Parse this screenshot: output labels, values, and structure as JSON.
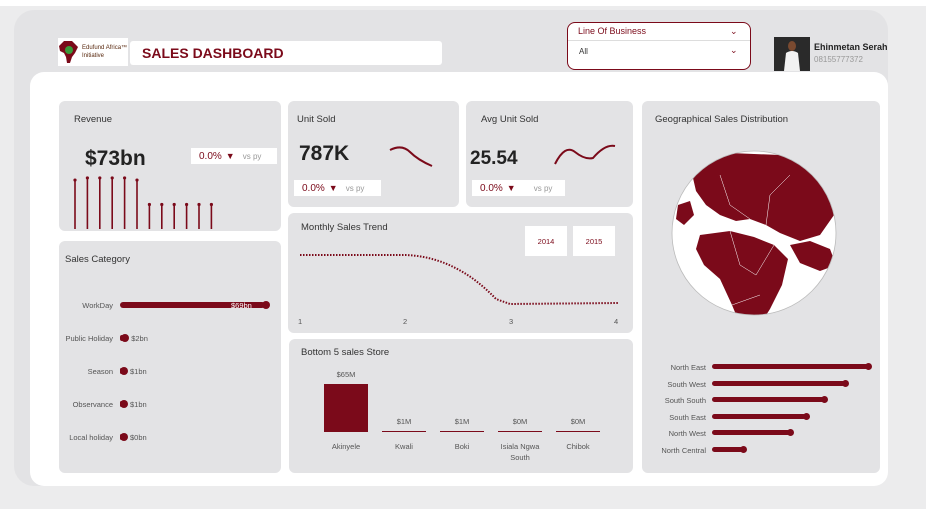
{
  "header": {
    "logo_line1": "Edufund Africa™",
    "logo_line2": "Initiative",
    "title": "SALES DASHBOARD",
    "filter_label": "Line Of Business",
    "filter_value": "All",
    "user_name": "Ehinmetan Serah",
    "user_phone": "08155777372"
  },
  "revenue": {
    "title": "Revenue",
    "value": "$73bn",
    "change": "0.0%",
    "vs": "vs py",
    "spark": [
      0.92,
      0.96,
      0.96,
      0.96,
      0.96,
      0.92,
      0.46,
      0.46,
      0.46,
      0.46,
      0.46,
      0.46
    ]
  },
  "units": {
    "title": "Unit Sold",
    "value": "787K",
    "change": "0.0%",
    "vs": "vs py"
  },
  "avg": {
    "title": "Avg Unit Sold",
    "value": "25.54",
    "change": "0.0%",
    "vs": "vs py"
  },
  "trend": {
    "title": "Monthly Sales Trend",
    "years": [
      "2014",
      "2015"
    ],
    "x_labels": [
      "1",
      "2",
      "3",
      "4"
    ]
  },
  "category": {
    "title": "Sales Category",
    "items": [
      {
        "label": "WorkDay",
        "value": "$69bn",
        "amount": 69
      },
      {
        "label": "Public Holiday",
        "value": "$2bn",
        "amount": 2
      },
      {
        "label": "Season",
        "value": "$1bn",
        "amount": 1
      },
      {
        "label": "Observance",
        "value": "$1bn",
        "amount": 1
      },
      {
        "label": "Local holiday",
        "value": "$0bn",
        "amount": 0
      }
    ]
  },
  "bottom": {
    "title": "Bottom 5 sales Store",
    "stores": [
      {
        "name": "Akinyele",
        "value": "$65M",
        "amount": 65
      },
      {
        "name": "Kwali",
        "value": "$1M",
        "amount": 1
      },
      {
        "name": "Boki",
        "value": "$1M",
        "amount": 1
      },
      {
        "name": "Isiala Ngwa South",
        "value": "$0M",
        "amount": 0
      },
      {
        "name": "Chibok",
        "value": "$0M",
        "amount": 0
      }
    ]
  },
  "geo": {
    "title": "Geographical Sales Distribution",
    "regions": [
      {
        "name": "North East",
        "amount": 1.0
      },
      {
        "name": "South West",
        "amount": 0.85
      },
      {
        "name": "South South",
        "amount": 0.72
      },
      {
        "name": "South East",
        "amount": 0.6
      },
      {
        "name": "North West",
        "amount": 0.5
      },
      {
        "name": "North Central",
        "amount": 0.2
      }
    ]
  },
  "colors": {
    "accent": "#7b0a1a",
    "card": "#e3e3e5"
  },
  "chart_data": [
    {
      "type": "bar",
      "title": "Sales Category",
      "categories": [
        "WorkDay",
        "Public Holiday",
        "Season",
        "Observance",
        "Local holiday"
      ],
      "values": [
        69,
        2,
        1,
        1,
        0
      ]
    },
    {
      "type": "bar",
      "title": "Bottom 5 sales Store",
      "categories": [
        "Akinyele",
        "Kwali",
        "Boki",
        "Isiala Ngwa South",
        "Chibok"
      ],
      "values": [
        65,
        1,
        1,
        0,
        0
      ]
    },
    {
      "type": "line",
      "title": "Monthly Sales Trend",
      "x": [
        1,
        2,
        3,
        4
      ]
    }
  ]
}
